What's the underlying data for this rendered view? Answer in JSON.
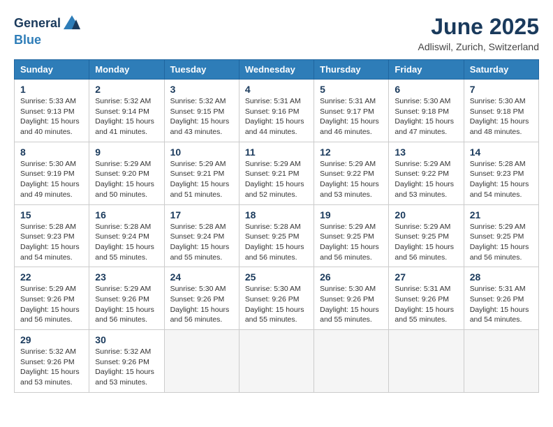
{
  "header": {
    "logo_general": "General",
    "logo_blue": "Blue",
    "month_title": "June 2025",
    "location": "Adliswil, Zurich, Switzerland"
  },
  "columns": [
    "Sunday",
    "Monday",
    "Tuesday",
    "Wednesday",
    "Thursday",
    "Friday",
    "Saturday"
  ],
  "weeks": [
    [
      {
        "day": "1",
        "info": "Sunrise: 5:33 AM\nSunset: 9:13 PM\nDaylight: 15 hours\nand 40 minutes."
      },
      {
        "day": "2",
        "info": "Sunrise: 5:32 AM\nSunset: 9:14 PM\nDaylight: 15 hours\nand 41 minutes."
      },
      {
        "day": "3",
        "info": "Sunrise: 5:32 AM\nSunset: 9:15 PM\nDaylight: 15 hours\nand 43 minutes."
      },
      {
        "day": "4",
        "info": "Sunrise: 5:31 AM\nSunset: 9:16 PM\nDaylight: 15 hours\nand 44 minutes."
      },
      {
        "day": "5",
        "info": "Sunrise: 5:31 AM\nSunset: 9:17 PM\nDaylight: 15 hours\nand 46 minutes."
      },
      {
        "day": "6",
        "info": "Sunrise: 5:30 AM\nSunset: 9:18 PM\nDaylight: 15 hours\nand 47 minutes."
      },
      {
        "day": "7",
        "info": "Sunrise: 5:30 AM\nSunset: 9:18 PM\nDaylight: 15 hours\nand 48 minutes."
      }
    ],
    [
      {
        "day": "8",
        "info": "Sunrise: 5:30 AM\nSunset: 9:19 PM\nDaylight: 15 hours\nand 49 minutes."
      },
      {
        "day": "9",
        "info": "Sunrise: 5:29 AM\nSunset: 9:20 PM\nDaylight: 15 hours\nand 50 minutes."
      },
      {
        "day": "10",
        "info": "Sunrise: 5:29 AM\nSunset: 9:21 PM\nDaylight: 15 hours\nand 51 minutes."
      },
      {
        "day": "11",
        "info": "Sunrise: 5:29 AM\nSunset: 9:21 PM\nDaylight: 15 hours\nand 52 minutes."
      },
      {
        "day": "12",
        "info": "Sunrise: 5:29 AM\nSunset: 9:22 PM\nDaylight: 15 hours\nand 53 minutes."
      },
      {
        "day": "13",
        "info": "Sunrise: 5:29 AM\nSunset: 9:22 PM\nDaylight: 15 hours\nand 53 minutes."
      },
      {
        "day": "14",
        "info": "Sunrise: 5:28 AM\nSunset: 9:23 PM\nDaylight: 15 hours\nand 54 minutes."
      }
    ],
    [
      {
        "day": "15",
        "info": "Sunrise: 5:28 AM\nSunset: 9:23 PM\nDaylight: 15 hours\nand 54 minutes."
      },
      {
        "day": "16",
        "info": "Sunrise: 5:28 AM\nSunset: 9:24 PM\nDaylight: 15 hours\nand 55 minutes."
      },
      {
        "day": "17",
        "info": "Sunrise: 5:28 AM\nSunset: 9:24 PM\nDaylight: 15 hours\nand 55 minutes."
      },
      {
        "day": "18",
        "info": "Sunrise: 5:28 AM\nSunset: 9:25 PM\nDaylight: 15 hours\nand 56 minutes."
      },
      {
        "day": "19",
        "info": "Sunrise: 5:29 AM\nSunset: 9:25 PM\nDaylight: 15 hours\nand 56 minutes."
      },
      {
        "day": "20",
        "info": "Sunrise: 5:29 AM\nSunset: 9:25 PM\nDaylight: 15 hours\nand 56 minutes."
      },
      {
        "day": "21",
        "info": "Sunrise: 5:29 AM\nSunset: 9:25 PM\nDaylight: 15 hours\nand 56 minutes."
      }
    ],
    [
      {
        "day": "22",
        "info": "Sunrise: 5:29 AM\nSunset: 9:26 PM\nDaylight: 15 hours\nand 56 minutes."
      },
      {
        "day": "23",
        "info": "Sunrise: 5:29 AM\nSunset: 9:26 PM\nDaylight: 15 hours\nand 56 minutes."
      },
      {
        "day": "24",
        "info": "Sunrise: 5:30 AM\nSunset: 9:26 PM\nDaylight: 15 hours\nand 56 minutes."
      },
      {
        "day": "25",
        "info": "Sunrise: 5:30 AM\nSunset: 9:26 PM\nDaylight: 15 hours\nand 55 minutes."
      },
      {
        "day": "26",
        "info": "Sunrise: 5:30 AM\nSunset: 9:26 PM\nDaylight: 15 hours\nand 55 minutes."
      },
      {
        "day": "27",
        "info": "Sunrise: 5:31 AM\nSunset: 9:26 PM\nDaylight: 15 hours\nand 55 minutes."
      },
      {
        "day": "28",
        "info": "Sunrise: 5:31 AM\nSunset: 9:26 PM\nDaylight: 15 hours\nand 54 minutes."
      }
    ],
    [
      {
        "day": "29",
        "info": "Sunrise: 5:32 AM\nSunset: 9:26 PM\nDaylight: 15 hours\nand 53 minutes."
      },
      {
        "day": "30",
        "info": "Sunrise: 5:32 AM\nSunset: 9:26 PM\nDaylight: 15 hours\nand 53 minutes."
      },
      {
        "day": "",
        "info": ""
      },
      {
        "day": "",
        "info": ""
      },
      {
        "day": "",
        "info": ""
      },
      {
        "day": "",
        "info": ""
      },
      {
        "day": "",
        "info": ""
      }
    ]
  ]
}
